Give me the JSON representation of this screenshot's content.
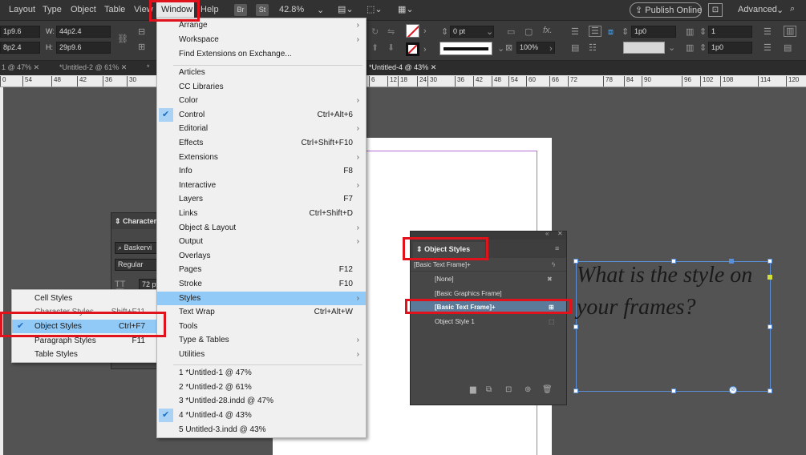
{
  "menubar": {
    "items": [
      "Layout",
      "Type",
      "Object",
      "Table",
      "View",
      "Window",
      "Help"
    ],
    "br": "Br",
    "st": "St",
    "zoom": "42.8%",
    "publish": "Publish Online",
    "workspace": "Advanced"
  },
  "control": {
    "x_val": "1p9.6",
    "y_val": "8p2.4",
    "w_label": "W:",
    "w_val": "44p2.4",
    "h_label": "H:",
    "h_val": "29p9.6",
    "stroke_weight": "0 pt",
    "percent": "100%",
    "gap_val": "1p0",
    "gap_val2": "1p0",
    "columns": "1"
  },
  "tabs": [
    "1 @ 47%",
    "*Untitled-2 @ 61%",
    "*",
    "*Untitled-4 @ 43%"
  ],
  "ruler": [
    "0",
    "54",
    "48",
    "42",
    "36",
    "30",
    "6",
    "12",
    "18",
    "24",
    "30",
    "36",
    "42",
    "48",
    "54",
    "60",
    "66",
    "72",
    "78",
    "84",
    "90",
    "96",
    "102",
    "108",
    "114",
    "120"
  ],
  "window_menu": {
    "items": [
      {
        "label": "Arrange",
        "key": "",
        "sub": true,
        "check": false
      },
      {
        "label": "Workspace",
        "key": "",
        "sub": true,
        "check": false
      },
      {
        "label": "Find Extensions on Exchange...",
        "key": "",
        "sub": false,
        "check": false
      },
      {
        "label": "Articles",
        "key": "",
        "sub": false,
        "check": false
      },
      {
        "label": "CC Libraries",
        "key": "",
        "sub": false,
        "check": false
      },
      {
        "label": "Color",
        "key": "",
        "sub": true,
        "check": false
      },
      {
        "label": "Control",
        "key": "Ctrl+Alt+6",
        "sub": false,
        "check": true
      },
      {
        "label": "Editorial",
        "key": "",
        "sub": true,
        "check": false
      },
      {
        "label": "Effects",
        "key": "Ctrl+Shift+F10",
        "sub": false,
        "check": false
      },
      {
        "label": "Extensions",
        "key": "",
        "sub": true,
        "check": false
      },
      {
        "label": "Info",
        "key": "F8",
        "sub": false,
        "check": false
      },
      {
        "label": "Interactive",
        "key": "",
        "sub": true,
        "check": false
      },
      {
        "label": "Layers",
        "key": "F7",
        "sub": false,
        "check": false
      },
      {
        "label": "Links",
        "key": "Ctrl+Shift+D",
        "sub": false,
        "check": false
      },
      {
        "label": "Object & Layout",
        "key": "",
        "sub": true,
        "check": false
      },
      {
        "label": "Output",
        "key": "",
        "sub": true,
        "check": false
      },
      {
        "label": "Overlays",
        "key": "",
        "sub": false,
        "check": false
      },
      {
        "label": "Pages",
        "key": "F12",
        "sub": false,
        "check": false
      },
      {
        "label": "Stroke",
        "key": "F10",
        "sub": false,
        "check": false
      },
      {
        "label": "Styles",
        "key": "",
        "sub": true,
        "check": false
      },
      {
        "label": "Text Wrap",
        "key": "Ctrl+Alt+W",
        "sub": false,
        "check": false
      },
      {
        "label": "Tools",
        "key": "",
        "sub": false,
        "check": false
      },
      {
        "label": "Type & Tables",
        "key": "",
        "sub": true,
        "check": false
      },
      {
        "label": "Utilities",
        "key": "",
        "sub": true,
        "check": false
      },
      {
        "label": "1 *Untitled-1 @ 47%",
        "key": "",
        "sub": false,
        "check": false
      },
      {
        "label": "2 *Untitled-2 @ 61%",
        "key": "",
        "sub": false,
        "check": false
      },
      {
        "label": "3 *Untitled-28.indd @ 47%",
        "key": "",
        "sub": false,
        "check": false
      },
      {
        "label": "4 *Untitled-4 @ 43%",
        "key": "",
        "sub": false,
        "check": true
      },
      {
        "label": "5 Untitled-3.indd @ 43%",
        "key": "",
        "sub": false,
        "check": false
      }
    ]
  },
  "styles_submenu": {
    "items": [
      {
        "label": "Cell Styles",
        "key": ""
      },
      {
        "label": "Character Styles",
        "key": "Shift+F11"
      },
      {
        "label": "Object Styles",
        "key": "Ctrl+F7"
      },
      {
        "label": "Paragraph Styles",
        "key": "F11"
      },
      {
        "label": "Table Styles",
        "key": ""
      }
    ]
  },
  "character_panel": {
    "title": "Character",
    "font": "Baskervi",
    "style": "Regular",
    "size": "72 pt"
  },
  "object_styles": {
    "title": "Object Styles",
    "current": "[Basic Text Frame]+",
    "items": [
      "[None]",
      "[Basic Graphics Frame]",
      "[Basic Text Frame]+",
      "Object Style 1"
    ]
  },
  "canvas": {
    "text": "What is the style on your frames?"
  },
  "colors": {
    "highlight_box": "#e0121b",
    "menu_highlight": "#91c9f7",
    "selection": "#5a8fd7"
  }
}
